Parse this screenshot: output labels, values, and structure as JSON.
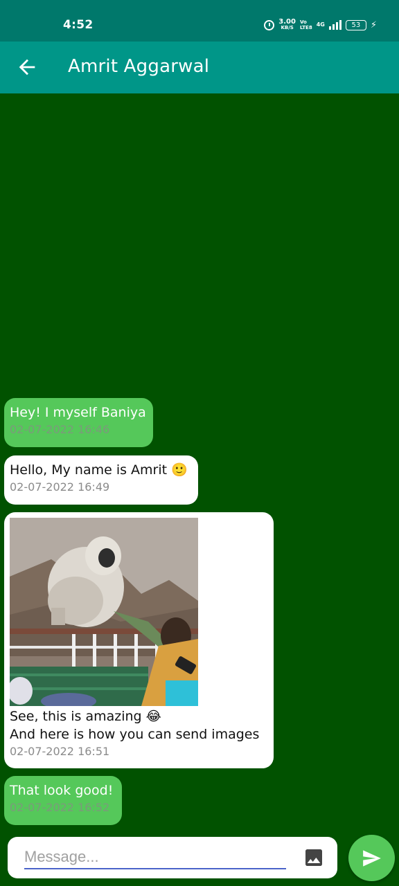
{
  "status_bar": {
    "time": "4:52",
    "speed_value": "3.00",
    "speed_unit": "KB/S",
    "volte_top": "Vo",
    "volte_bottom": "LTE8",
    "network": "4G",
    "battery": "53",
    "icons": [
      "alarm-icon",
      "signal-icon",
      "battery-icon",
      "charging-icon"
    ]
  },
  "app_bar": {
    "title": "Amrit Aggarwal",
    "back_icon": "arrow-left-icon"
  },
  "messages": [
    {
      "direction": "sent",
      "text": "Hey! I myself Baniya",
      "time": "02-07-2022 16:46"
    },
    {
      "direction": "received",
      "text": "Hello, My name is Amrit 🙂",
      "time": "02-07-2022 16:49"
    },
    {
      "direction": "received",
      "has_image": true,
      "image_subject": "langur monkey on railing",
      "text": "See, this is amazing 😂\nAnd here is how you can send images",
      "time": "02-07-2022 16:51"
    },
    {
      "direction": "sent",
      "text": "That look good!",
      "time": "02-07-2022 16:52"
    }
  ],
  "composer": {
    "placeholder": "Message...",
    "image_icon": "image-icon",
    "send_icon": "send-icon"
  },
  "colors": {
    "status_bar": "#00786b",
    "app_bar": "#009688",
    "background": "#015200",
    "sent_bubble": "#55c85a",
    "received_bubble": "#ffffff",
    "input_underline": "#4a63c9"
  }
}
